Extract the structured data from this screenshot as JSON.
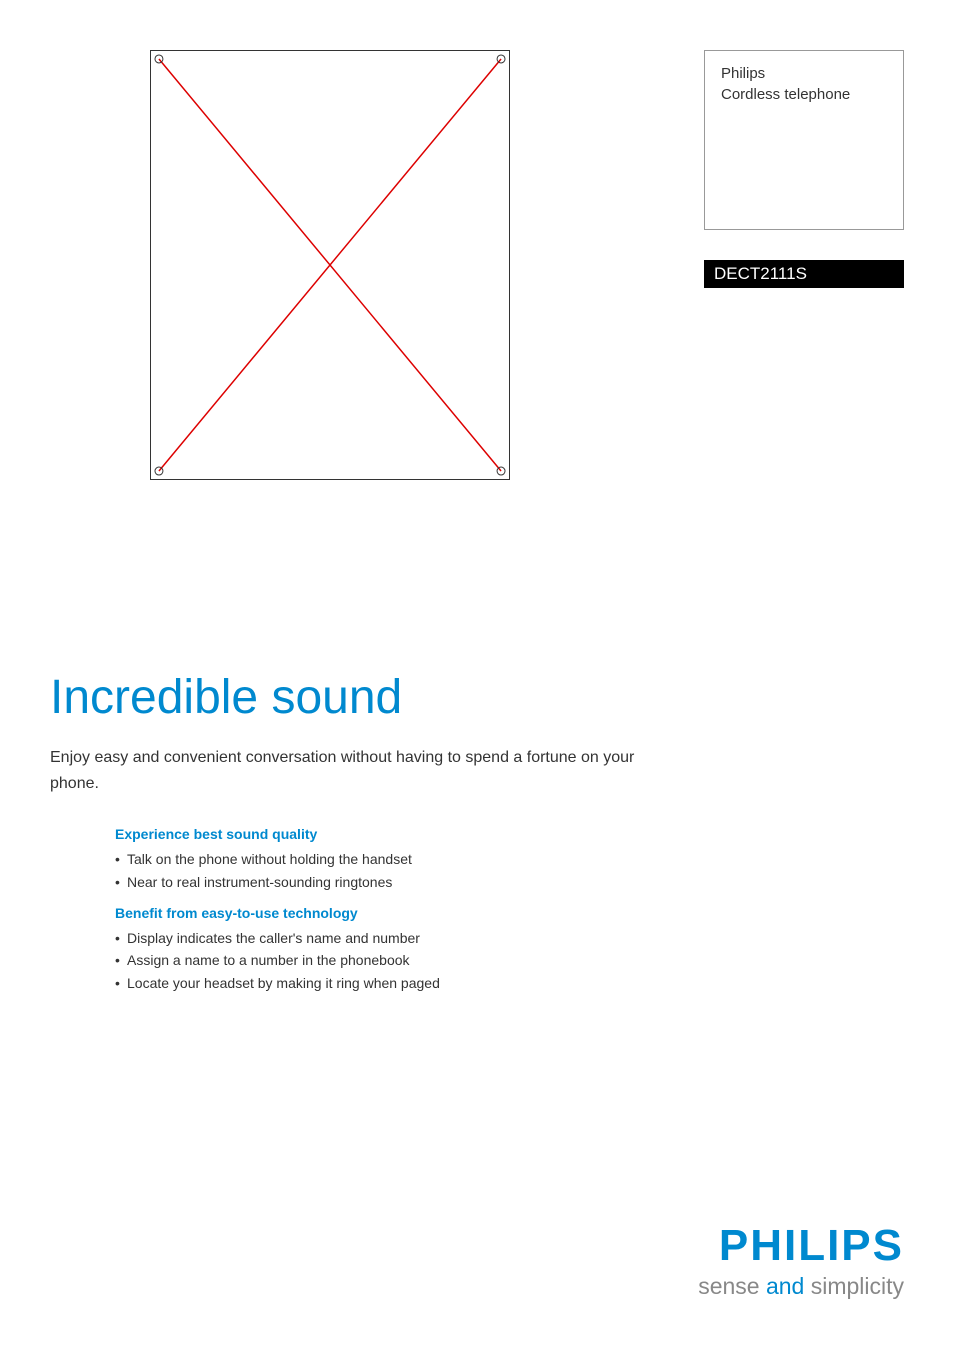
{
  "info": {
    "brand": "Philips",
    "product_type": "Cordless telephone"
  },
  "model": "DECT2111S",
  "main": {
    "heading": "Incredible sound",
    "description": "Enjoy easy and convenient conversation without having to spend a fortune on your phone."
  },
  "sections": [
    {
      "heading": "Experience best sound quality",
      "items": [
        "Talk on the phone without holding the handset",
        "Near to real instrument-sounding ringtones"
      ]
    },
    {
      "heading": "Benefit from easy-to-use technology",
      "items": [
        "Display indicates the caller's name and number",
        "Assign a name to a number in the phonebook",
        "Locate your headset by making it ring when paged"
      ]
    }
  ],
  "footer": {
    "brand": "PHILIPS",
    "tagline_before": "sense ",
    "tagline_and": "and",
    "tagline_after": " simplicity"
  }
}
